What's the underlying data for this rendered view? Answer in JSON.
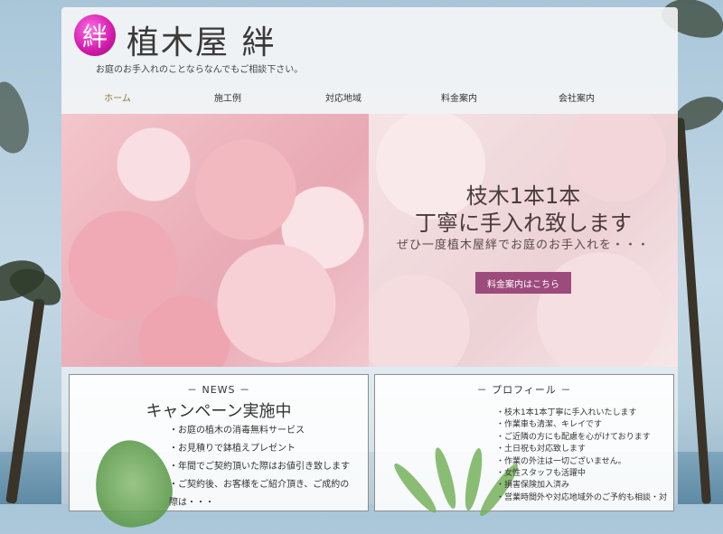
{
  "site": {
    "logo_char": "絆",
    "title": "植木屋 絆",
    "tagline": "お庭のお手入れのことならなんでもご相談下さい。"
  },
  "nav": [
    {
      "label": "ホーム"
    },
    {
      "label": "施工例"
    },
    {
      "label": "対応地域"
    },
    {
      "label": "料金案内"
    },
    {
      "label": "会社案内"
    }
  ],
  "hero": {
    "heading_line1": "枝木1本1本",
    "heading_line2": "丁寧に手入れ致します",
    "subheading": "ぜひ一度植木屋絆でお庭のお手入れを・・・",
    "button_label": "料金案内はこちら"
  },
  "news": {
    "label": "－ NEWS －",
    "heading": "キャンペーン実施中",
    "items": [
      "・お庭の植木の消毒無料サービス",
      "・お見積りで鉢植えプレゼント",
      "・年間でご契約頂いた際はお値引き致します",
      "・ご契約後、お客様をご紹介頂き、ご成約の",
      "際は・・・"
    ]
  },
  "profile": {
    "label": "－ プロフィール －",
    "items": [
      "・枝木1本1本丁寧に手入れいたします",
      "・作業車も清潔、キレイです",
      "・ご近隣の方にも配慮を心がけております",
      "・土日祝も対応致します",
      "・作業の外注は一切ございません。",
      "・女性スタッフも活躍中",
      "・損害保険加入済み",
      "・営業時間外や対応地域外のご予約も相談・対"
    ]
  },
  "colors": {
    "accent": "#9d4a7c",
    "logo": "#d11aa9",
    "nav_active": "#8a7a3a"
  }
}
